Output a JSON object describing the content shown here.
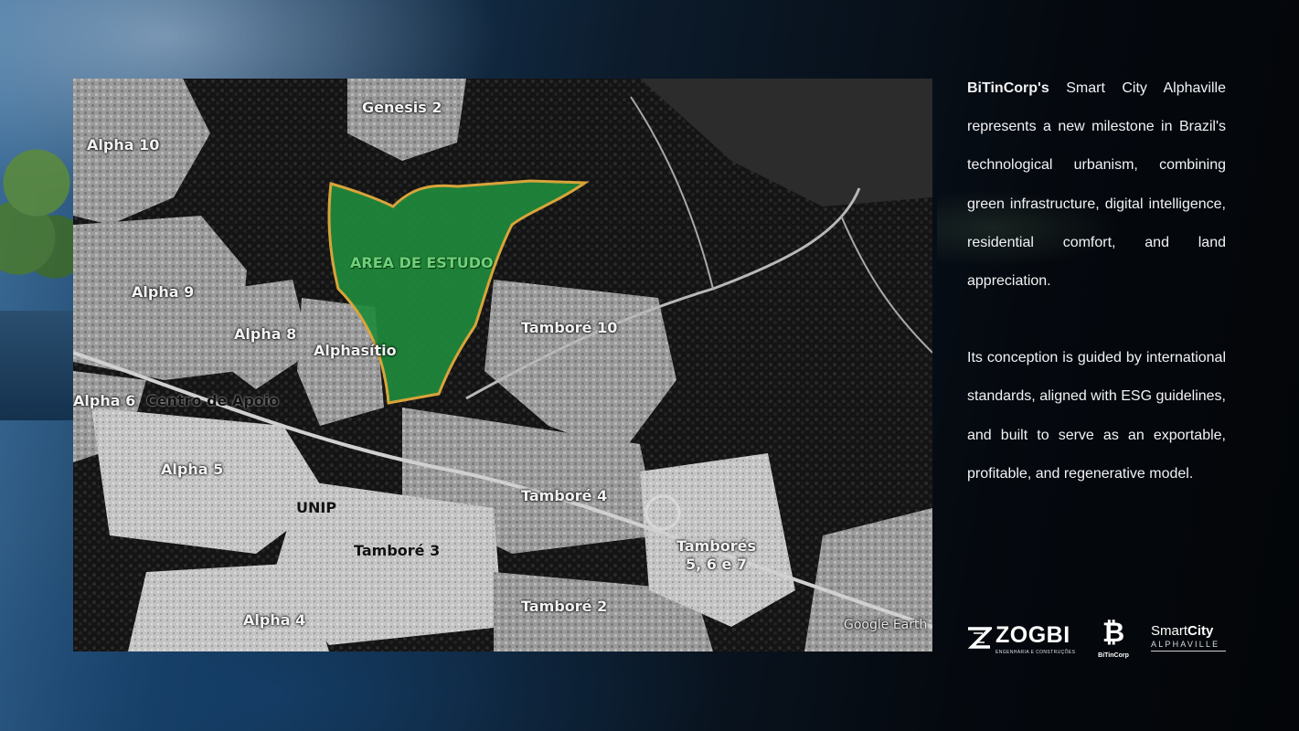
{
  "map": {
    "labels": {
      "genesis2": "Genesis 2",
      "alpha10": "Alpha 10",
      "area_estudo": "AREA DE ESTUDO",
      "alpha9": "Alpha 9",
      "alpha8": "Alpha 8",
      "alphasitio": "Alphasítio",
      "tambore10": "Tamboré 10",
      "alpha6": "Alpha 6",
      "centro_apoio": "Centro de Apoio",
      "alpha5": "Alpha 5",
      "unip": "UNIP",
      "tambore4": "Tamboré 4",
      "tambore3": "Tamboré 3",
      "tambores567_line1": "Tamborés",
      "tambores567_line2": "5, 6 e 7",
      "tambore2": "Tamboré 2",
      "alpha4": "Alpha 4",
      "attribution": "Google Earth"
    },
    "colors": {
      "study_area_fill": "#1f8a3c",
      "study_area_border": "#d9a43a"
    }
  },
  "text": {
    "p1_brand": "BiTinCorp's",
    "p1_rest": " Smart City Alphaville represents a new milestone in Brazil's technological urbanism, combining green infrastructure, digital intelligence, residential comfort, and land appreciation.",
    "p2": "Its conception is guided by international standards, aligned with ESG guidelines, and built to serve as an exportable, profitable, and regenerative model."
  },
  "logos": {
    "zogbi_word": "ZOGBI",
    "zogbi_sub": "ENGENHARIA E CONSTRUÇÕES",
    "bitin_symbol": "₿",
    "bitin_word": "BiTinCorp",
    "smartcity_light": "Smart",
    "smartcity_bold": "City",
    "smartcity_sub": "ALPHAVILLE"
  }
}
